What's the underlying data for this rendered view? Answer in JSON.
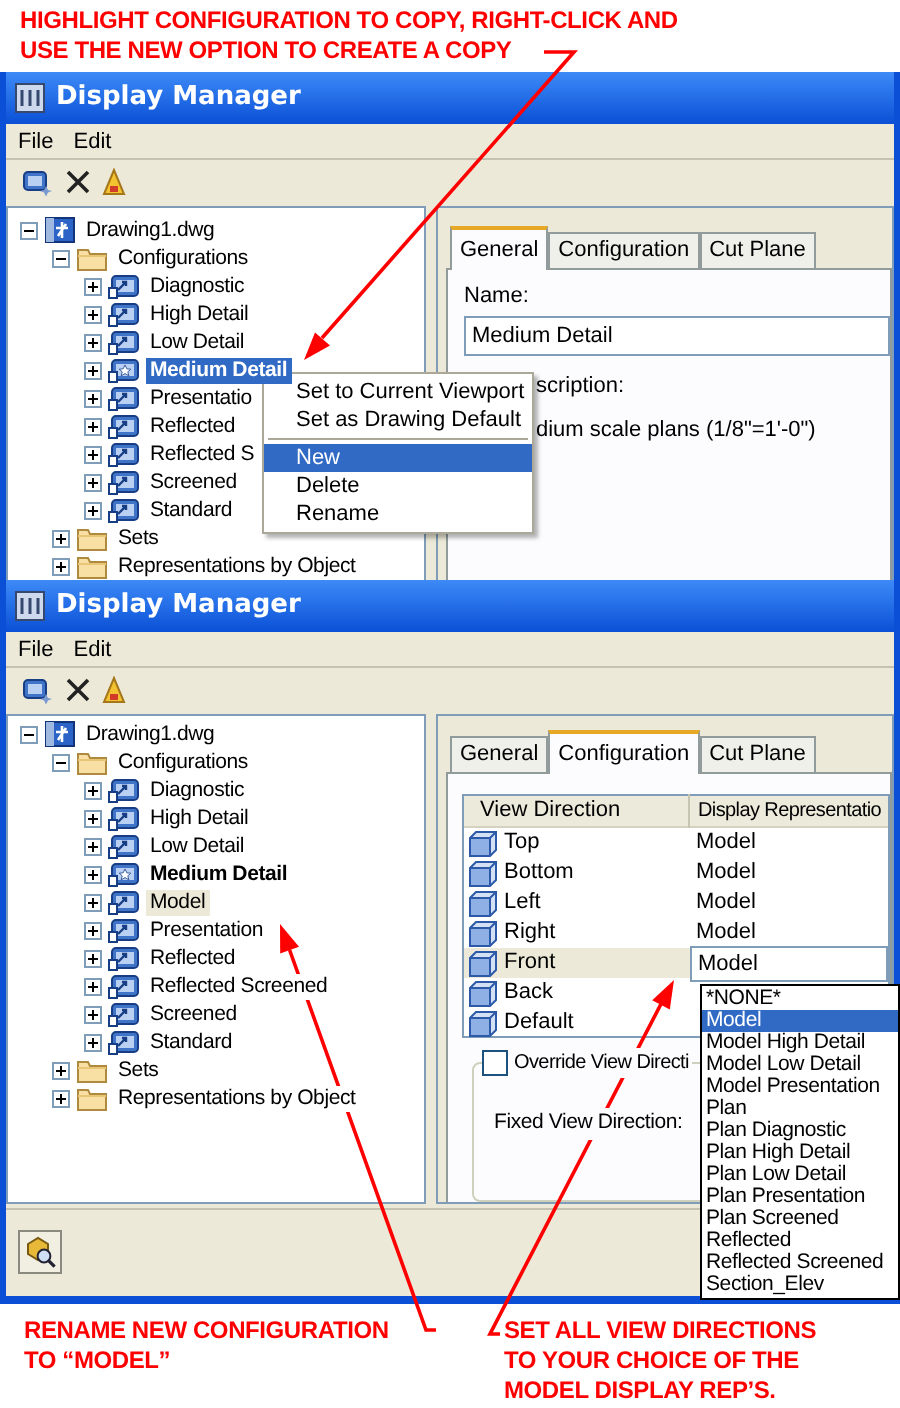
{
  "top_note": {
    "lines": [
      "HIGHLIGHT CONFIGURATION TO COPY, RIGHT-CLICK AND",
      "USE THE NEW OPTION TO CREATE A COPY"
    ]
  },
  "window_1": {
    "title": "Display Manager",
    "menu": [
      "File",
      "Edit"
    ],
    "tree_focused": true,
    "tree": [
      {
        "kind": "drawing",
        "label": "Drawing1.dwg",
        "expanded": true,
        "selected": false,
        "children": [
          {
            "kind": "folder",
            "label": "Configurations",
            "expanded": true,
            "selected": false,
            "children": [
              {
                "kind": "configuration",
                "label": "Diagnostic",
                "expanded": false,
                "selected": false,
                "current": false
              },
              {
                "kind": "configuration",
                "label": "High Detail",
                "expanded": false,
                "selected": false,
                "current": false
              },
              {
                "kind": "configuration",
                "label": "Low Detail",
                "expanded": false,
                "selected": false,
                "current": false
              },
              {
                "kind": "configuration",
                "label": "Medium Detail",
                "expanded": false,
                "selected": true,
                "current": true
              },
              {
                "kind": "configuration",
                "label": "Presentatio",
                "expanded": false,
                "selected": false,
                "current": false
              },
              {
                "kind": "configuration",
                "label": "Reflected",
                "expanded": false,
                "selected": false,
                "current": false
              },
              {
                "kind": "configuration",
                "label": "Reflected S",
                "expanded": false,
                "selected": false,
                "current": false
              },
              {
                "kind": "configuration",
                "label": "Screened",
                "expanded": false,
                "selected": false,
                "current": false
              },
              {
                "kind": "configuration",
                "label": "Standard",
                "expanded": false,
                "selected": false,
                "current": false
              }
            ]
          },
          {
            "kind": "folder",
            "label": "Sets",
            "expanded": false,
            "selected": false
          },
          {
            "kind": "folder",
            "label": "Representations by Object",
            "expanded": false,
            "selected": false
          }
        ]
      }
    ],
    "context_menu": [
      {
        "kind": "item",
        "label": "Set to Current Viewport",
        "selected": false
      },
      {
        "kind": "item",
        "label": "Set as Drawing Default",
        "selected": false
      },
      {
        "kind": "separator"
      },
      {
        "kind": "item",
        "label": "New",
        "selected": true
      },
      {
        "kind": "item",
        "label": "Delete",
        "selected": false
      },
      {
        "kind": "item",
        "label": "Rename",
        "selected": false
      }
    ],
    "tabs": [
      {
        "label": "General",
        "selected": true
      },
      {
        "label": "Configuration",
        "selected": false
      },
      {
        "label": "Cut Plane",
        "selected": false
      }
    ],
    "name_label": "Name:",
    "name_value": "Medium Detail",
    "description_label": "scription:",
    "description_value": "dium scale plans (1/8\"=1'-0\")"
  },
  "window_2": {
    "title": "Display Manager",
    "menu": [
      "File",
      "Edit"
    ],
    "tree_focused": false,
    "tree": [
      {
        "kind": "drawing",
        "label": "Drawing1.dwg",
        "expanded": true,
        "selected": false,
        "children": [
          {
            "kind": "folder",
            "label": "Configurations",
            "expanded": true,
            "selected": false,
            "children": [
              {
                "kind": "configuration",
                "label": "Diagnostic",
                "expanded": false,
                "selected": false,
                "current": false
              },
              {
                "kind": "configuration",
                "label": "High Detail",
                "expanded": false,
                "selected": false,
                "current": false
              },
              {
                "kind": "configuration",
                "label": "Low Detail",
                "expanded": false,
                "selected": false,
                "current": false
              },
              {
                "kind": "configuration",
                "label": "Medium Detail",
                "expanded": false,
                "selected": false,
                "current": true
              },
              {
                "kind": "configuration",
                "label": "Model",
                "expanded": false,
                "selected": true,
                "current": false
              },
              {
                "kind": "configuration",
                "label": "Presentation",
                "expanded": false,
                "selected": false,
                "current": false
              },
              {
                "kind": "configuration",
                "label": "Reflected",
                "expanded": false,
                "selected": false,
                "current": false
              },
              {
                "kind": "configuration",
                "label": "Reflected Screened",
                "expanded": false,
                "selected": false,
                "current": false
              },
              {
                "kind": "configuration",
                "label": "Screened",
                "expanded": false,
                "selected": false,
                "current": false
              },
              {
                "kind": "configuration",
                "label": "Standard",
                "expanded": false,
                "selected": false,
                "current": false
              }
            ]
          },
          {
            "kind": "folder",
            "label": "Sets",
            "expanded": false,
            "selected": false
          },
          {
            "kind": "folder",
            "label": "Representations by Object",
            "expanded": false,
            "selected": false
          }
        ]
      }
    ],
    "tabs": [
      {
        "label": "General",
        "selected": false
      },
      {
        "label": "Configuration",
        "selected": true
      },
      {
        "label": "Cut Plane",
        "selected": false
      }
    ],
    "table": {
      "columns": [
        "View Direction",
        "Display Representatio"
      ],
      "rows": [
        {
          "view": "Top",
          "representation": "Model",
          "selected": false
        },
        {
          "view": "Bottom",
          "representation": "Model",
          "selected": false
        },
        {
          "view": "Left",
          "representation": "Model",
          "selected": false
        },
        {
          "view": "Right",
          "representation": "Model",
          "selected": false
        },
        {
          "view": "Front",
          "representation": "Model",
          "selected": true
        },
        {
          "view": "Back",
          "representation": "",
          "selected": false
        },
        {
          "view": "Default",
          "representation": "",
          "selected": false
        }
      ]
    },
    "dropdown": [
      {
        "label": "*NONE*",
        "selected": false
      },
      {
        "label": "Model",
        "selected": true
      },
      {
        "label": "Model High Detail",
        "selected": false
      },
      {
        "label": "Model Low Detail",
        "selected": false
      },
      {
        "label": "Model Presentation",
        "selected": false
      },
      {
        "label": "Plan",
        "selected": false
      },
      {
        "label": "Plan Diagnostic",
        "selected": false
      },
      {
        "label": "Plan High Detail",
        "selected": false
      },
      {
        "label": "Plan Low Detail",
        "selected": false
      },
      {
        "label": "Plan Presentation",
        "selected": false
      },
      {
        "label": "Plan Screened",
        "selected": false
      },
      {
        "label": "Reflected",
        "selected": false
      },
      {
        "label": "Reflected Screened",
        "selected": false
      },
      {
        "label": "Section_Elev",
        "selected": false
      }
    ],
    "override_checkbox": {
      "label": "Override View Directi",
      "checked": false
    },
    "fixed_view_label": "Fixed View Direction:"
  },
  "bottom_notes": [
    {
      "lines": [
        "RENAME NEW CONFIGURATION",
        "TO “MODEL”"
      ]
    },
    {
      "lines": [
        "SET ALL VIEW DIRECTIONS",
        "TO YOUR CHOICE OF THE",
        "MODEL DISPLAY REP’S."
      ]
    }
  ]
}
